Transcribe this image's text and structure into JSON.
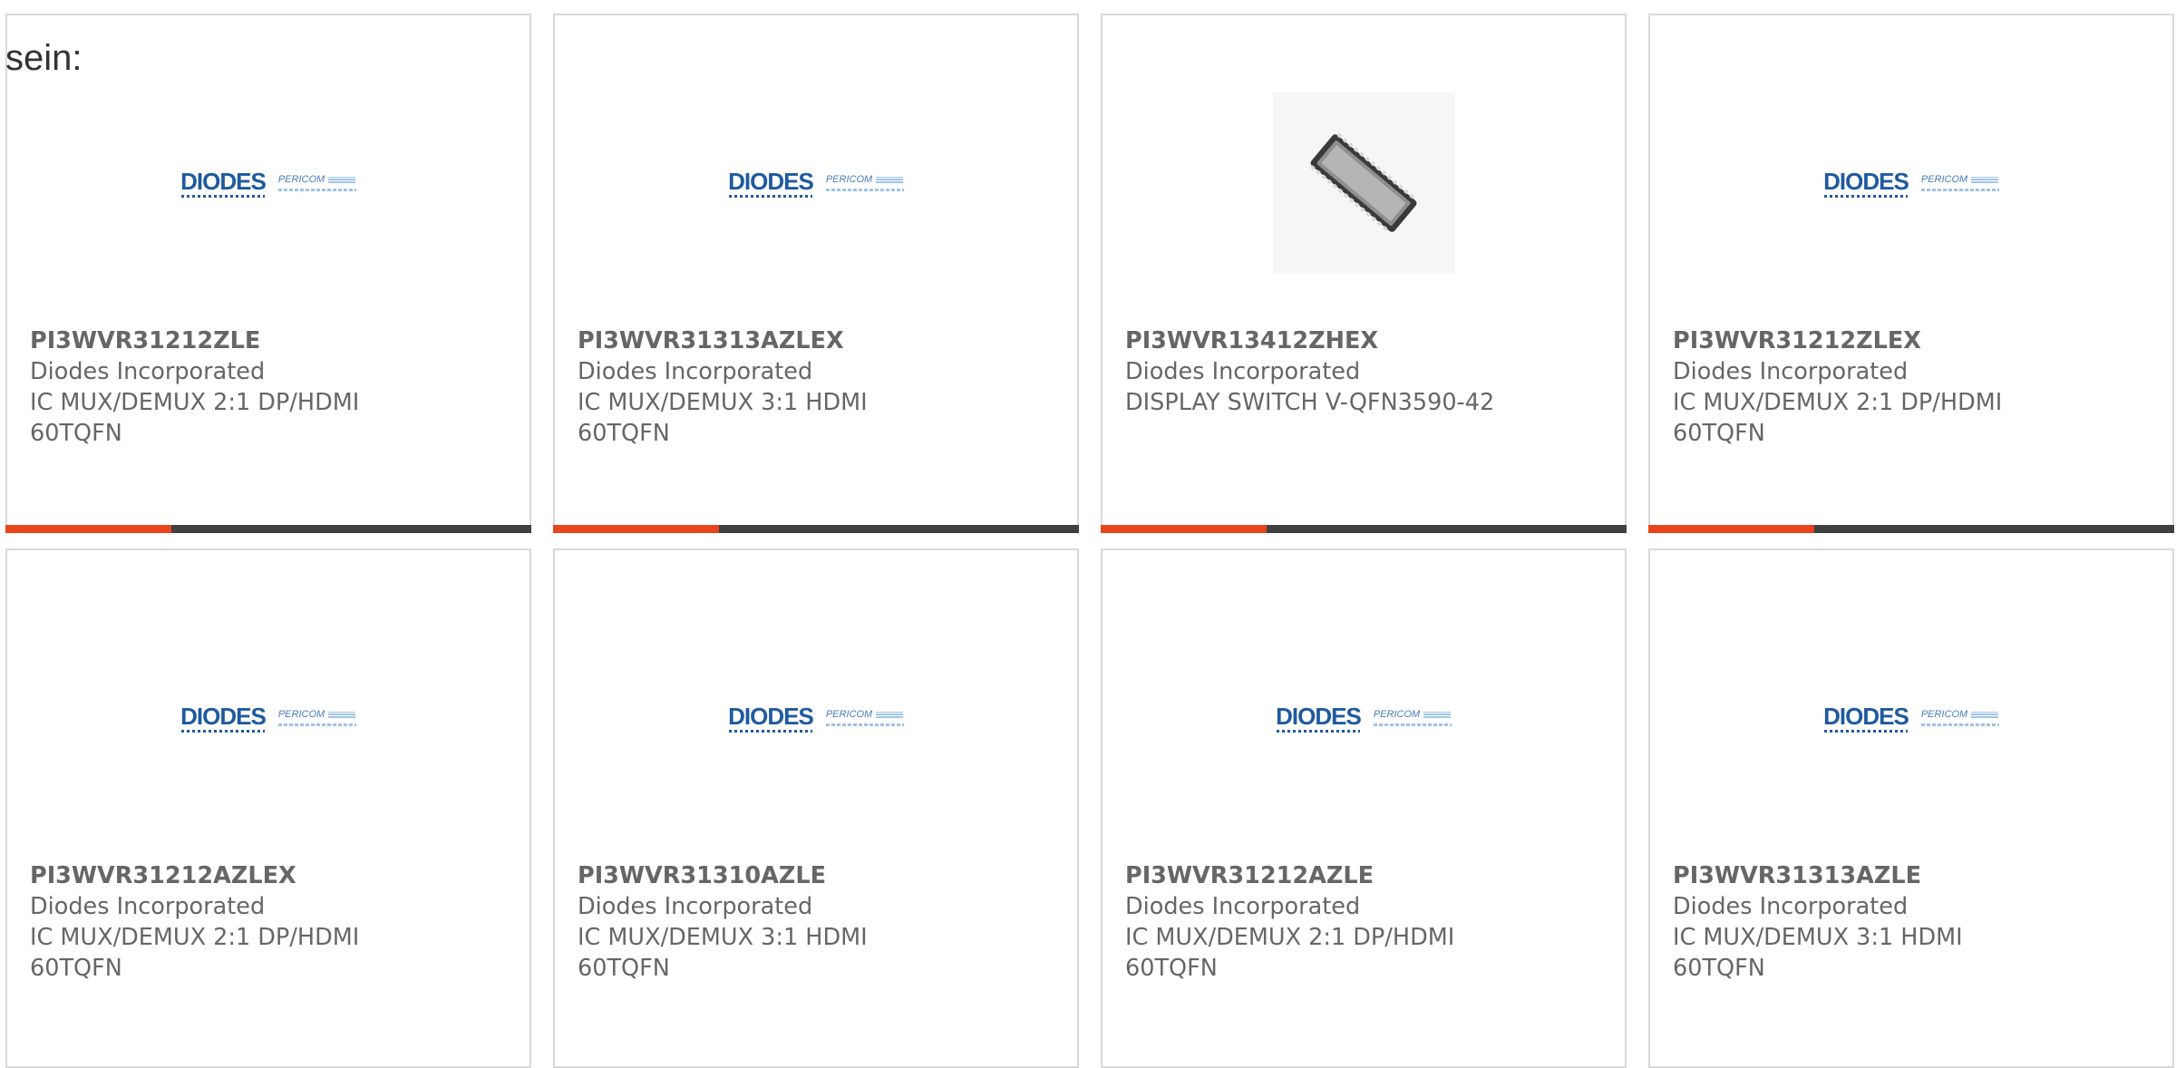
{
  "intro_text": "sein:",
  "colors": {
    "bar_accent": "#e8451c",
    "bar_dark": "#404040"
  },
  "cards": [
    {
      "part_number": "PI3WVR31212ZLE",
      "manufacturer": "Diodes Incorporated",
      "description_lines": [
        "IC MUX/DEMUX 2:1 DP/HDMI",
        "60TQFN"
      ],
      "image": "diodes-pericom-logo",
      "logo": {
        "brand": "DIODES",
        "sub_brand": "PERICOM"
      }
    },
    {
      "part_number": "PI3WVR31313AZLEX",
      "manufacturer": "Diodes Incorporated",
      "description_lines": [
        "IC MUX/DEMUX 3:1 HDMI",
        "60TQFN"
      ],
      "image": "diodes-pericom-logo",
      "logo": {
        "brand": "DIODES",
        "sub_brand": "PERICOM"
      }
    },
    {
      "part_number": "PI3WVR13412ZHEX",
      "manufacturer": "Diodes Incorporated",
      "description_lines": [
        "DISPLAY SWITCH V-QFN3590-42"
      ],
      "image": "qfn-chip-photo"
    },
    {
      "part_number": "PI3WVR31212ZLEX",
      "manufacturer": "Diodes Incorporated",
      "description_lines": [
        "IC MUX/DEMUX 2:1 DP/HDMI",
        "60TQFN"
      ],
      "image": "diodes-pericom-logo",
      "logo": {
        "brand": "DIODES",
        "sub_brand": "PERICOM"
      }
    },
    {
      "part_number": "PI3WVR31212AZLEX",
      "manufacturer": "Diodes Incorporated",
      "description_lines": [
        "IC MUX/DEMUX 2:1 DP/HDMI",
        "60TQFN"
      ],
      "image": "diodes-pericom-logo",
      "logo": {
        "brand": "DIODES",
        "sub_brand": "PERICOM"
      }
    },
    {
      "part_number": "PI3WVR31310AZLE",
      "manufacturer": "Diodes Incorporated",
      "description_lines": [
        "IC MUX/DEMUX 3:1 HDMI",
        "60TQFN"
      ],
      "image": "diodes-pericom-logo",
      "logo": {
        "brand": "DIODES",
        "sub_brand": "PERICOM"
      }
    },
    {
      "part_number": "PI3WVR31212AZLE",
      "manufacturer": "Diodes Incorporated",
      "description_lines": [
        "IC MUX/DEMUX 2:1 DP/HDMI",
        "60TQFN"
      ],
      "image": "diodes-pericom-logo",
      "logo": {
        "brand": "DIODES",
        "sub_brand": "PERICOM"
      }
    },
    {
      "part_number": "PI3WVR31313AZLE",
      "manufacturer": "Diodes Incorporated",
      "description_lines": [
        "IC MUX/DEMUX 3:1 HDMI",
        "60TQFN"
      ],
      "image": "diodes-pericom-logo",
      "logo": {
        "brand": "DIODES",
        "sub_brand": "PERICOM"
      }
    }
  ]
}
